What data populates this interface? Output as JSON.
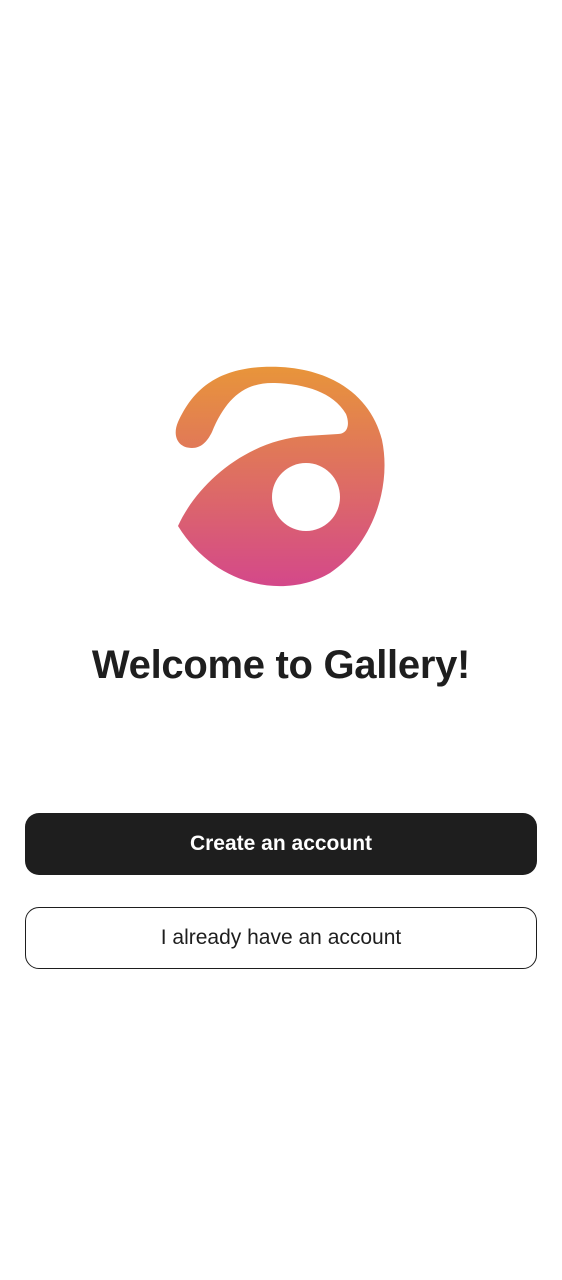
{
  "app": {
    "logo_icon": "gallery-logo-icon",
    "logo_colors": {
      "top": "#E8953A",
      "bottom": "#D4488A"
    }
  },
  "welcome": {
    "title": "Welcome to Gallery!"
  },
  "actions": {
    "create_account_label": "Create an account",
    "existing_account_label": "I already have an account"
  },
  "colors": {
    "primary_button_bg": "#1E1E1E",
    "primary_button_text": "#FFFFFF",
    "secondary_button_border": "#1E1E1E",
    "background": "#FFFFFF"
  }
}
